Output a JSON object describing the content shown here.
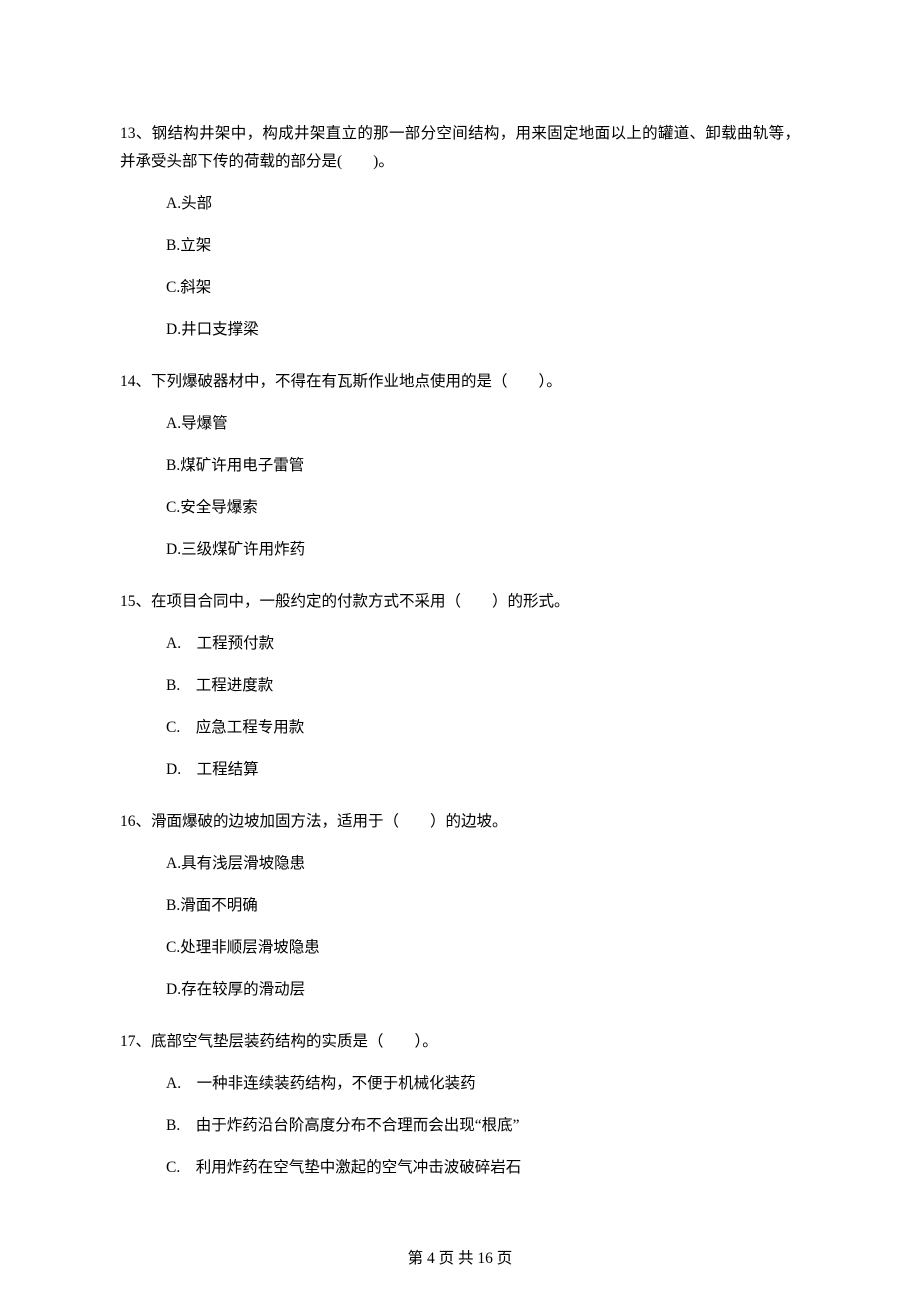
{
  "q13": {
    "text": "13、钢结构井架中，构成井架直立的那一部分空间结构，用来固定地面以上的罐道、卸载曲轨等，并承受头部下传的荷载的部分是(　　)。",
    "a": "A.头部",
    "b": "B.立架",
    "c": "C.斜架",
    "d": "D.井口支撑梁"
  },
  "q14": {
    "text": "14、下列爆破器材中，不得在有瓦斯作业地点使用的是（　　）。",
    "a": "A.导爆管",
    "b": "B.煤矿许用电子雷管",
    "c": "C.安全导爆索",
    "d": "D.三级煤矿许用炸药"
  },
  "q15": {
    "text": "15、在项目合同中，一般约定的付款方式不采用（　　）的形式。",
    "a": "A.　工程预付款",
    "b": "B.　工程进度款",
    "c": "C.　应急工程专用款",
    "d": "D.　工程结算"
  },
  "q16": {
    "text": "16、滑面爆破的边坡加固方法，适用于（　　）的边坡。",
    "a": "A.具有浅层滑坡隐患",
    "b": "B.滑面不明确",
    "c": "C.处理非顺层滑坡隐患",
    "d": "D.存在较厚的滑动层"
  },
  "q17": {
    "text": "17、底部空气垫层装药结构的实质是（　　）。",
    "a": "A.　一种非连续装药结构，不便于机械化装药",
    "b": "B.　由于炸药沿台阶高度分布不合理而会出现“根底”",
    "c": "C.　利用炸药在空气垫中激起的空气冲击波破碎岩石"
  },
  "footer": "第 4 页 共 16 页"
}
